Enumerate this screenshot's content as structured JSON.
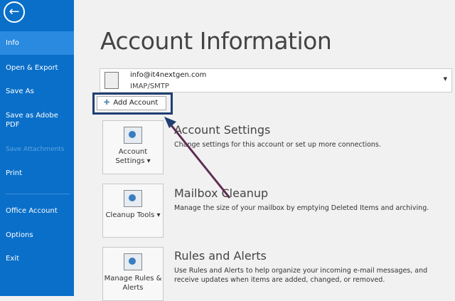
{
  "sidebar": {
    "items": [
      {
        "label": "Info",
        "state": "selected"
      },
      {
        "label": "Open & Export"
      },
      {
        "label": "Save As"
      },
      {
        "label": "Save as Adobe PDF"
      },
      {
        "label": "Save Attachments",
        "state": "disabled"
      },
      {
        "label": "Print"
      },
      {
        "label": "Office Account"
      },
      {
        "label": "Options"
      },
      {
        "label": "Exit"
      }
    ]
  },
  "main": {
    "title": "Account Information",
    "account": {
      "email": "info@it4nextgen.com",
      "type": "IMAP/SMTP"
    },
    "add_account": "Add Account",
    "sections": [
      {
        "tile": "Account Settings",
        "title": "Account Settings",
        "desc": "Change settings for this account or set up more connections."
      },
      {
        "tile": "Cleanup Tools",
        "title": "Mailbox Cleanup",
        "desc": "Manage the size of your mailbox by emptying Deleted Items and archiving."
      },
      {
        "tile": "Manage Rules & Alerts",
        "title": "Rules and Alerts",
        "desc": "Use Rules and Alerts to help organize your incoming e-mail messages, and receive updates when items are added, changed, or removed."
      }
    ]
  },
  "colors": {
    "sidebar": "#0a6fc9",
    "highlight": "#1f3f73",
    "arrow": "#1f3f73"
  }
}
